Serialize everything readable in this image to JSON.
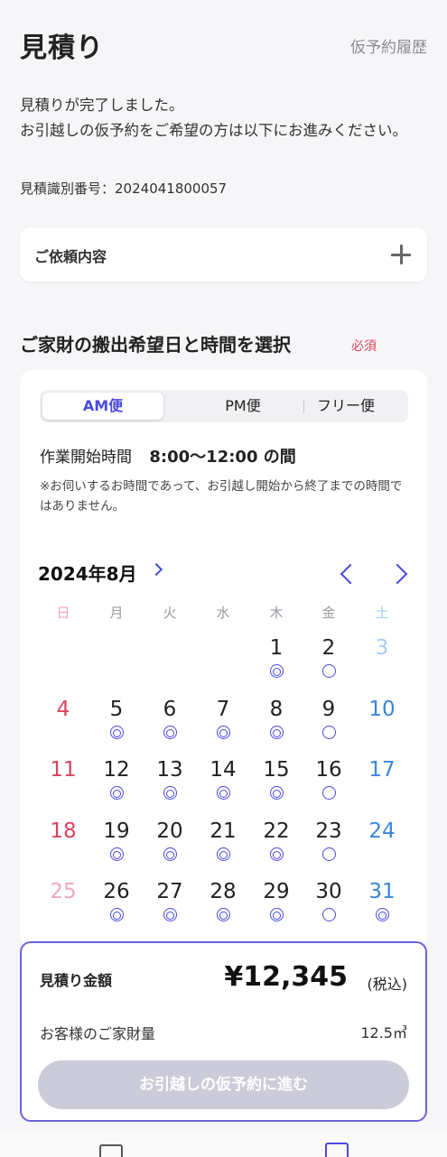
{
  "header": {
    "title": "見積り",
    "history_link": "仮予約履歴"
  },
  "estimate": {
    "message_line1": "見積りが完了しました。",
    "message_line2": "お引越しの仮予約をご希望の方は以下にお進みください。",
    "id_label": "見積識別番号：",
    "id_value": "2024041800057"
  },
  "request": {
    "label": "ご依頼内容"
  },
  "schedule": {
    "title": "ご家財の搬出希望日と時間を選択",
    "required": "必須",
    "tabs": [
      "AM便",
      "PM便",
      "フリー便"
    ],
    "selected_tab": "AM便",
    "time_label": "作業開始時間",
    "time_value": "8:00〜12:00 の間",
    "note": "※お伺いするお時間であって、お引越し開始から終了までの時間ではありません。"
  },
  "calendar": {
    "month": "2024年8月",
    "weekdays": [
      "日",
      "月",
      "火",
      "水",
      "木",
      "金",
      "土"
    ],
    "days": [
      {
        "day": "1",
        "mark": "◎"
      },
      {
        "day": "2",
        "mark": "○"
      },
      {
        "day": "3",
        "mark": ""
      },
      {
        "day": "4",
        "mark": ""
      },
      {
        "day": "5",
        "mark": "◎"
      },
      {
        "day": "6",
        "mark": "◎"
      },
      {
        "day": "7",
        "mark": "◎"
      },
      {
        "day": "8",
        "mark": "◎"
      },
      {
        "day": "9",
        "mark": "○"
      },
      {
        "day": "10",
        "mark": ""
      },
      {
        "day": "11",
        "mark": ""
      },
      {
        "day": "12",
        "mark": "◎"
      },
      {
        "day": "13",
        "mark": "◎"
      },
      {
        "day": "14",
        "mark": "◎"
      },
      {
        "day": "15",
        "mark": "◎"
      },
      {
        "day": "16",
        "mark": "○"
      },
      {
        "day": "17",
        "mark": ""
      },
      {
        "day": "18",
        "mark": ""
      },
      {
        "day": "19",
        "mark": "◎"
      },
      {
        "day": "20",
        "mark": "◎"
      },
      {
        "day": "21",
        "mark": "◎"
      },
      {
        "day": "22",
        "mark": "◎"
      },
      {
        "day": "23",
        "mark": "○"
      },
      {
        "day": "24",
        "mark": ""
      },
      {
        "day": "25",
        "mark": ""
      },
      {
        "day": "26",
        "mark": "◎"
      },
      {
        "day": "27",
        "mark": "◎"
      },
      {
        "day": "28",
        "mark": "◎"
      },
      {
        "day": "29",
        "mark": "◎"
      },
      {
        "day": "30",
        "mark": "○"
      },
      {
        "day": "31",
        "mark": "◎"
      }
    ]
  },
  "price": {
    "label": "見積り金額",
    "amount": "¥12,345",
    "tax": "(税込)",
    "volume_label": "お客様のご家財量",
    "volume_value": "12.5㎥",
    "cta": "お引越しの仮予約に進む"
  },
  "colors": {
    "accent": "#4a4adf",
    "sunday": "#d8445d",
    "saturday": "#3a86d8",
    "cta_disabled": "#cccbd9"
  }
}
